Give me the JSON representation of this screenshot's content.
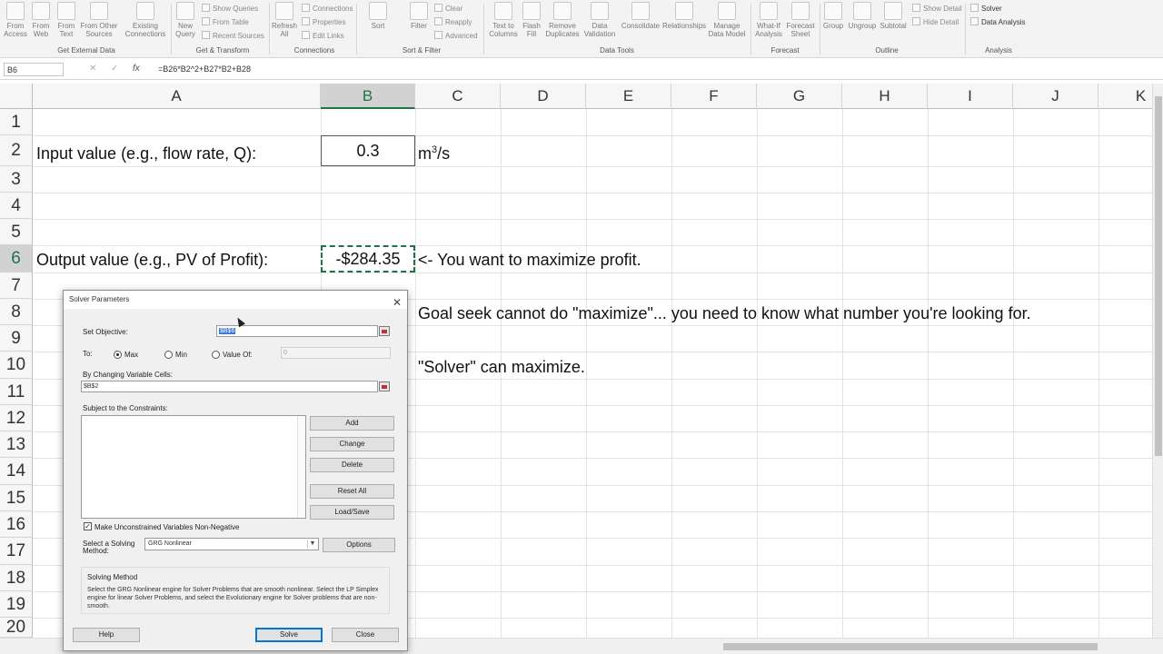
{
  "ribbon": {
    "get_external_data": {
      "group_label": "Get External Data",
      "buttons": [
        "From Access",
        "From Web",
        "From Text",
        "From Other Sources",
        "Existing Connections"
      ]
    },
    "get_transform": {
      "group_label": "Get & Transform",
      "new_query": "New Query",
      "small": [
        "Show Queries",
        "From Table",
        "Recent Sources"
      ]
    },
    "connections": {
      "group_label": "Connections",
      "refresh_all": "Refresh All",
      "small": [
        "Connections",
        "Properties",
        "Edit Links"
      ]
    },
    "sort_filter": {
      "group_label": "Sort & Filter",
      "sort": "Sort",
      "filter": "Filter",
      "small": [
        "Clear",
        "Reapply",
        "Advanced"
      ]
    },
    "data_tools": {
      "group_label": "Data Tools",
      "buttons": [
        "Text to Columns",
        "Flash Fill",
        "Remove Duplicates",
        "Data Validation",
        "Consolidate",
        "Relationships",
        "Manage Data Model"
      ]
    },
    "forecast": {
      "group_label": "Forecast",
      "buttons": [
        "What-If Analysis",
        "Forecast Sheet"
      ]
    },
    "outline": {
      "group_label": "Outline",
      "buttons": [
        "Group",
        "Ungroup",
        "Subtotal"
      ],
      "small": [
        "Show Detail",
        "Hide Detail"
      ]
    },
    "analysis": {
      "group_label": "Analysis",
      "small": [
        "Solver",
        "Data Analysis"
      ]
    }
  },
  "formula_bar": {
    "name_box": "B6",
    "cancel_icon": "✕",
    "enter_icon": "✓",
    "fx": "fx",
    "formula": "=B26*B2^2+B27*B2+B28"
  },
  "sheet": {
    "columns": [
      "A",
      "B",
      "C",
      "D",
      "E",
      "F",
      "G",
      "H",
      "I",
      "J",
      "K"
    ],
    "selected_column": "B",
    "rows": [
      "1",
      "2",
      "3",
      "4",
      "5",
      "6",
      "7",
      "8",
      "9",
      "10",
      "11",
      "12",
      "13",
      "14",
      "15",
      "16",
      "17",
      "18",
      "19",
      "20"
    ],
    "selected_row": "6",
    "cells": {
      "A2": "Input value (e.g., flow rate, Q):",
      "B2": "0.3",
      "C2_unit": "m",
      "C2_sup": "3",
      "C2_tail": "/s",
      "A6": "Output value (e.g., PV of Profit):",
      "B6": "-$284.35",
      "C6": "<- You want to maximize profit.",
      "C8": "Goal seek cannot do \"maximize\"... you need to know what number you're looking for.",
      "C10": "\"Solver\" can maximize."
    }
  },
  "solver_dialog": {
    "title": "Solver Parameters",
    "set_objective_label": "Set Objective:",
    "set_objective_value": "$B$6",
    "to_label": "To:",
    "option_max": "Max",
    "option_min": "Min",
    "option_value_of": "Value Of:",
    "value_of_value": "0",
    "selected_option": "Max",
    "changing_cells_label": "By Changing Variable Cells:",
    "changing_cells_value": "$B$2",
    "constraints_label": "Subject to the Constraints:",
    "buttons": {
      "add": "Add",
      "change": "Change",
      "delete": "Delete",
      "reset_all": "Reset All",
      "load_save": "Load/Save",
      "options": "Options",
      "help": "Help",
      "solve": "Solve",
      "close": "Close"
    },
    "nonnegative_label": "Make Unconstrained Variables Non-Negative",
    "nonnegative_checked": true,
    "method_label_line1": "Select a Solving",
    "method_label_line2": "Method:",
    "method_value": "GRG Nonlinear",
    "method_box_title": "Solving Method",
    "method_desc": "Select the GRG Nonlinear engine for Solver Problems that are smooth nonlinear. Select the LP Simplex engine for linear Solver Problems, and select the Evolutionary engine for Solver problems that are non-smooth."
  },
  "colors": {
    "excel_green": "#217346",
    "selection_header": "#d2d2d2",
    "default_button": "#0078d7"
  }
}
